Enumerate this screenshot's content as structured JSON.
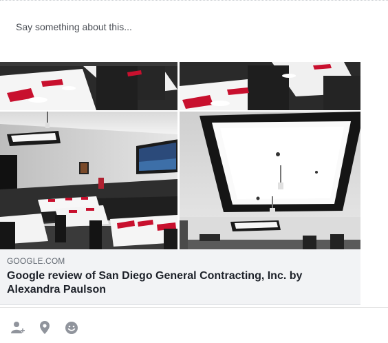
{
  "composer": {
    "placeholder": "Say something about this..."
  },
  "link_preview": {
    "domain": "GOOGLE.COM",
    "title": "Google review of San Diego General Contracting, Inc. by Alexandra Paulson"
  },
  "actions": [
    {
      "icon": "tag-friends-icon"
    },
    {
      "icon": "location-pin-icon"
    },
    {
      "icon": "feeling-smiley-icon"
    }
  ],
  "colors": {
    "card_bg": "#f2f3f5",
    "domain_text": "#606770",
    "title_text": "#1d2129",
    "icon_gray": "#90949c",
    "accent_red": "#c8102e"
  }
}
